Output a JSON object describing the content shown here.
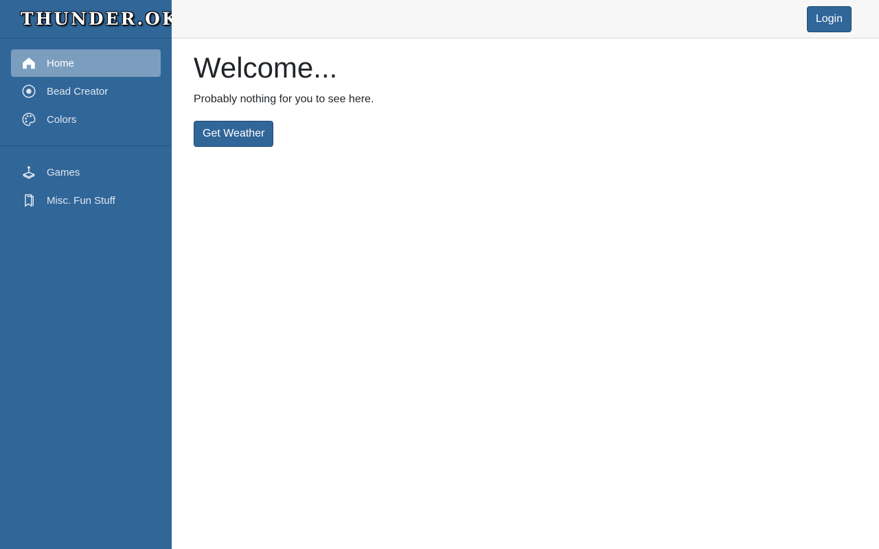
{
  "sidebar": {
    "logo_text": "THUNDER.OK",
    "items": [
      {
        "label": "Home",
        "icon": "home-icon"
      },
      {
        "label": "Bead Creator",
        "icon": "record-circle-icon"
      },
      {
        "label": "Colors",
        "icon": "palette-icon"
      }
    ],
    "items2": [
      {
        "label": "Games",
        "icon": "joystick-icon"
      },
      {
        "label": "Misc. Fun Stuff",
        "icon": "bookmark-icon"
      }
    ]
  },
  "topbar": {
    "login_label": "Login"
  },
  "main": {
    "title": "Welcome...",
    "text": "Probably nothing for you to see here.",
    "weather_button": "Get Weather"
  },
  "colors": {
    "sidebar_bg": "#316699",
    "active_item_bg": "#7b9ebf",
    "button_bg": "#316699"
  }
}
